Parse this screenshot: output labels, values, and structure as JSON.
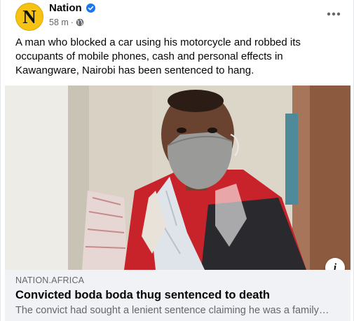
{
  "post": {
    "page_name": "Nation",
    "avatar_letter": "N",
    "timestamp": "58 m",
    "meta_separator": "·",
    "caption": "A man who blocked a car using his motorcycle and robbed its occupants of mobile phones, cash and personal effects in Kawangware, Nairobi has been sentenced to hang."
  },
  "link_preview": {
    "domain": "NATION.AFRICA",
    "title": "Convicted boda boda thug sentenced to death",
    "description": "The convict had sought a lenient sentence claiming he was a family…"
  },
  "icons": {
    "verified": "verified-badge-icon",
    "audience": "globe-icon",
    "more": "more-options-icon",
    "info": "info-icon"
  },
  "colors": {
    "verified_blue": "#1877f2",
    "avatar_yellow": "#f6c213",
    "secondary_text": "#65676b",
    "link_box_bg": "#f0f2f5"
  }
}
